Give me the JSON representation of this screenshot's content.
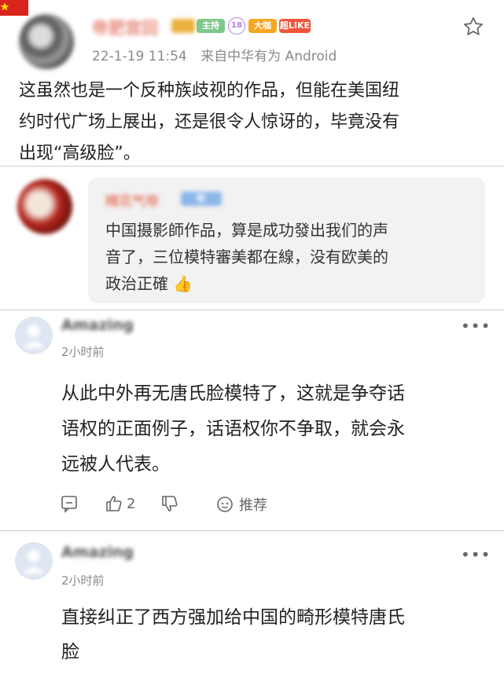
{
  "weibo_post": {
    "username": "帝肥宫回",
    "badges": [
      "主持",
      "18",
      "大咖",
      "超LIKE"
    ],
    "timestamp": "22-1-19 11:54",
    "source": "来自中华有为 Android",
    "text_lines": [
      "这虽然也是一个反种族歧视的作品，但能在美国纽",
      "约时代广场上展出，还是很令人惊讶的，毕竟没有",
      "出现“高级脸”。"
    ],
    "icons": {
      "favorite": "star-outline-icon"
    }
  },
  "reply": {
    "username": "晴花气帝",
    "badge": "粉",
    "text_lines": [
      "中国摄影師作品，算是成功發出我们的声",
      "音了，三位模特審美都在線，没有欧美的",
      "政治正確"
    ],
    "emoji": "👍"
  },
  "comments": [
    {
      "username": "Amazing",
      "time": "2小时前",
      "text_lines": [
        "从此中外再无唐氏脸模特了，这就是争夺话",
        "语权的正面例子，话语权你不争取，就会永",
        "远被人代表。"
      ],
      "like_count": "2",
      "recommend_label": "推荐"
    },
    {
      "username": "Amazing",
      "time": "2小时前",
      "text_lines": [
        "直接纠正了西方强加给中国的畸形模特唐氏",
        "脸"
      ]
    }
  ],
  "colors": {
    "divider": "#cfcfcf",
    "reply_bubble": "#f2f2f2",
    "badge_green": "#7dc88a",
    "badge_purple": "#b57ce6",
    "badge_orange": "#f5a623",
    "badge_red": "#f0543c"
  }
}
